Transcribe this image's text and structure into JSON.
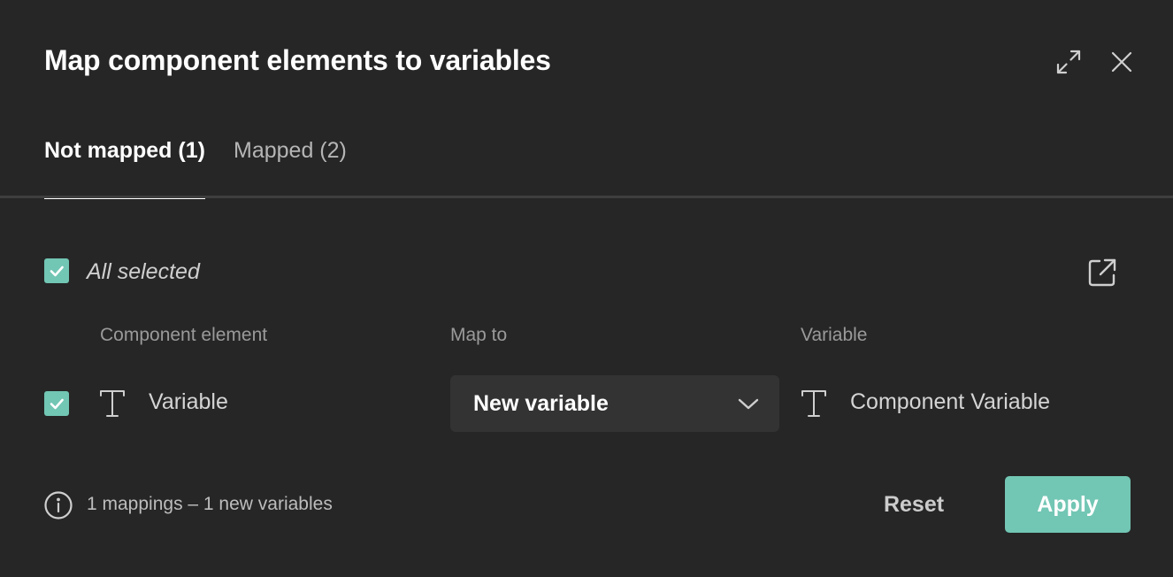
{
  "dialog": {
    "title": "Map component elements to variables",
    "expand_icon": "expand-arrows-icon",
    "close_icon": "close-icon"
  },
  "tabs": [
    {
      "label": "Not mapped (1)",
      "active": true
    },
    {
      "label": "Mapped (2)",
      "active": false
    }
  ],
  "selection": {
    "label": "All selected",
    "checked": true,
    "open_icon": "open-external-icon"
  },
  "table": {
    "headers": {
      "element": "Component element",
      "map_to": "Map to",
      "variable": "Variable"
    },
    "rows": [
      {
        "checked": true,
        "element_icon": "text-type-icon",
        "element": "Variable",
        "map_to": "New variable",
        "variable_icon": "text-type-icon",
        "variable": "Component Variable"
      }
    ]
  },
  "footer": {
    "info_icon": "info-icon",
    "summary": "1 mappings – 1 new variables",
    "reset_label": "Reset",
    "apply_label": "Apply"
  },
  "colors": {
    "background": "#262626",
    "accent": "#72c6b4",
    "select_bg": "#333333",
    "divider": "#3e3e3e"
  }
}
